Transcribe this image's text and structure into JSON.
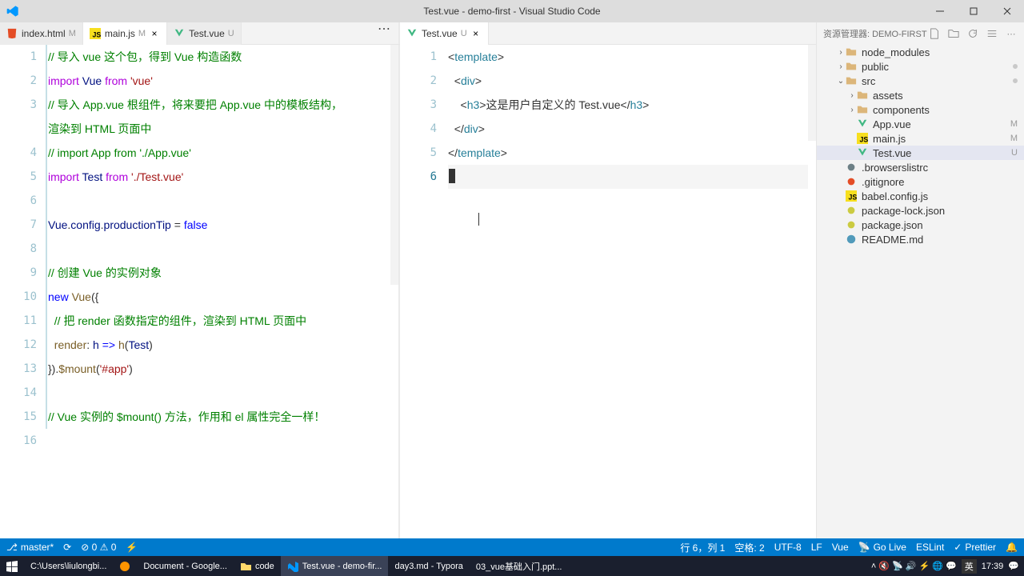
{
  "title": "Test.vue - demo-first - Visual Studio Code",
  "tabs": {
    "left": [
      {
        "name": "index.html",
        "suffix": "M",
        "icon": "html",
        "active": false
      },
      {
        "name": "main.js",
        "suffix": "M",
        "icon": "js",
        "active": true
      },
      {
        "name": "Test.vue",
        "suffix": "U",
        "icon": "vue",
        "active": false
      }
    ],
    "right": [
      {
        "name": "Test.vue",
        "suffix": "U",
        "icon": "vue",
        "active": true
      }
    ]
  },
  "explorer": {
    "title": "资源管理器: DEMO-FIRST",
    "tree": [
      {
        "name": "node_modules",
        "kind": "folder",
        "indent": 1,
        "chev": "›",
        "color": "green"
      },
      {
        "name": "public",
        "kind": "folder",
        "indent": 1,
        "chev": "›",
        "color": "yellow",
        "dot": true
      },
      {
        "name": "src",
        "kind": "folder",
        "indent": 1,
        "chev": "⌄",
        "color": "green",
        "dot": true
      },
      {
        "name": "assets",
        "kind": "folder",
        "indent": 2,
        "chev": "›",
        "color": "yellow"
      },
      {
        "name": "components",
        "kind": "folder",
        "indent": 2,
        "chev": "›",
        "color": "yellow"
      },
      {
        "name": "App.vue",
        "kind": "vue",
        "indent": 2,
        "badge": "M"
      },
      {
        "name": "main.js",
        "kind": "js",
        "indent": 2,
        "badge": "M"
      },
      {
        "name": "Test.vue",
        "kind": "vue",
        "indent": 2,
        "badge": "U",
        "sel": true
      },
      {
        "name": ".browserslistrc",
        "kind": "config",
        "indent": 1
      },
      {
        "name": ".gitignore",
        "kind": "git",
        "indent": 1
      },
      {
        "name": "babel.config.js",
        "kind": "js",
        "indent": 1
      },
      {
        "name": "package-lock.json",
        "kind": "json",
        "indent": 1
      },
      {
        "name": "package.json",
        "kind": "json",
        "indent": 1
      },
      {
        "name": "README.md",
        "kind": "md",
        "indent": 1
      }
    ]
  },
  "status": {
    "branch": "master*",
    "sync": "⟳",
    "errors": "⊘ 0 ⚠ 0",
    "port": "⚡",
    "pos": "行 6，列 1",
    "spaces": "空格: 2",
    "encoding": "UTF-8",
    "eol": "LF",
    "lang": "Vue",
    "golive": "Go Live",
    "eslint": "ESLint",
    "prettier": "Prettier",
    "bell": "🔔"
  },
  "taskbar": {
    "items": [
      {
        "label": "",
        "icon": "win"
      },
      {
        "label": "C:\\Users\\liulongbi..."
      },
      {
        "label": "",
        "icon": "ff"
      },
      {
        "label": "Document - Google..."
      },
      {
        "label": "code",
        "icon": "folder"
      },
      {
        "label": "Test.vue - demo-fir...",
        "icon": "vsc",
        "active": true
      },
      {
        "label": "day3.md - Typora"
      },
      {
        "label": "03_vue基础入门.ppt..."
      }
    ],
    "tray": {
      "icons": "˄ 🔇 📡 🔊 ⚡ 🌐 💬",
      "ime": "英",
      "time": "17:39",
      "notif": "💬"
    }
  },
  "leftEditor": {
    "lines": [
      "// 导入 vue 这个包，得到 Vue 构造函数",
      "import Vue from 'vue'",
      "// 导入 App.vue 根组件，将来要把 App.vue 中的模板结构，",
      "渲染到 HTML 页面中",
      "// import App from './App.vue'",
      "import Test from './Test.vue'",
      "",
      "Vue.config.productionTip = false",
      "",
      "// 创建 Vue 的实例对象",
      "new Vue({",
      "  // 把 render 函数指定的组件，渲染到 HTML 页面中",
      "  render: h => h(Test)",
      "}).$mount('#app')",
      "",
      "// Vue 实例的 $mount() 方法，作用和 el 属性完全一样！",
      ""
    ],
    "lineCount": 16
  },
  "rightEditor": {
    "lines": [
      "<template>",
      "  <div>",
      "    <h3>这是用户自定义的 Test.vue</h3>",
      "  </div>",
      "</template>",
      ""
    ],
    "lineCount": 6,
    "activeLine": 6
  }
}
